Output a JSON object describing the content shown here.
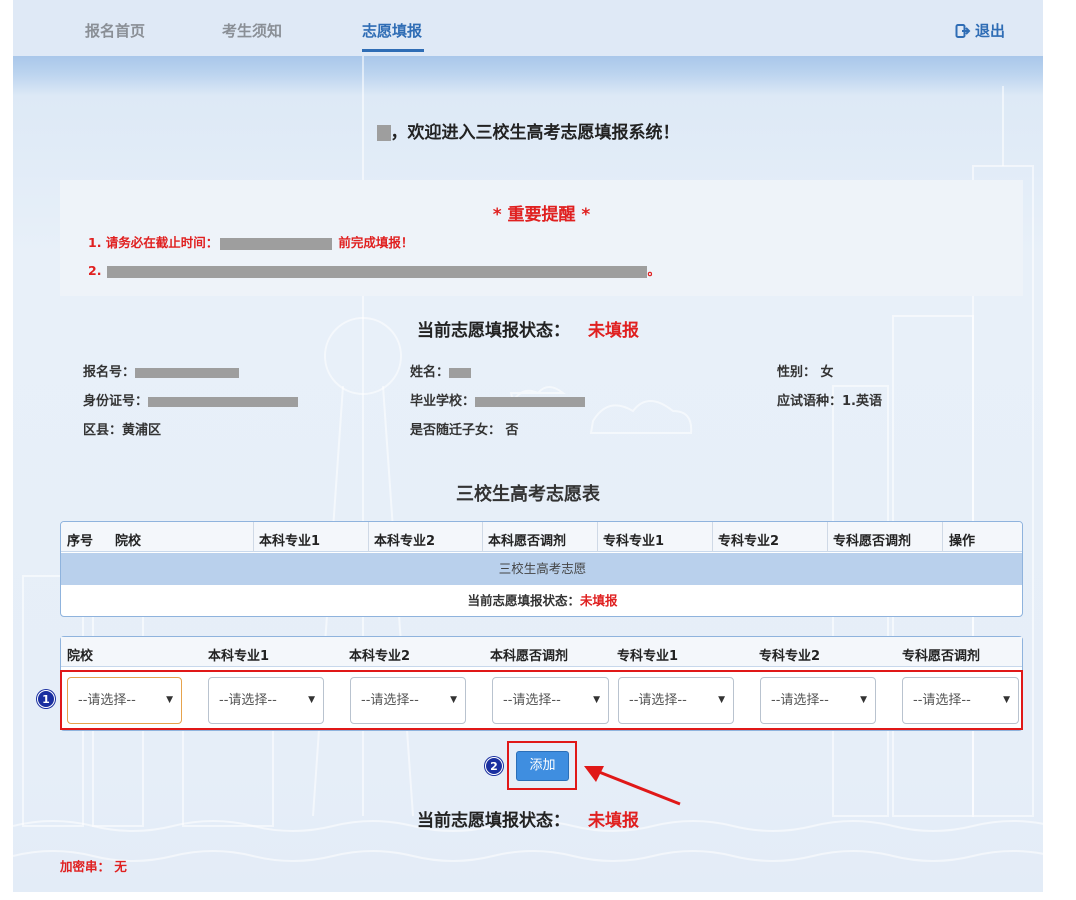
{
  "nav": {
    "tabs": [
      {
        "label": "报名首页",
        "active": false
      },
      {
        "label": "考生须知",
        "active": false
      },
      {
        "label": "志愿填报",
        "active": true
      }
    ],
    "logout_label": "退出"
  },
  "welcome": {
    "text": "，欢迎进入三校生高考志愿填报系统！"
  },
  "notice": {
    "title": "* 重要提醒 *",
    "line1_prefix": "1. 请务必在截止时间：",
    "line1_suffix": "前完成填报！",
    "line2_prefix": "2.",
    "line2_suffix": "。"
  },
  "status": {
    "label": "当前志愿填报状态：",
    "value": "未填报"
  },
  "student": {
    "reg_no_label": "报名号：",
    "name_label": "姓名：",
    "gender_label": "性别：",
    "gender_value": "女",
    "id_label": "身份证号：",
    "school_label": "毕业学校：",
    "language_label": "应试语种：",
    "language_value": "1.英语",
    "district_label": "区县：",
    "district_value": "黄浦区",
    "migrant_label": "是否随迁子女：",
    "migrant_value": "否"
  },
  "table_title": "三校生高考志愿表",
  "summary_table": {
    "headers": [
      "序号",
      "院校",
      "本科专业1",
      "本科专业2",
      "本科愿否调剂",
      "专科专业1",
      "专科专业2",
      "专科愿否调剂",
      "操作"
    ],
    "group_label": "三校生高考志愿",
    "status_label": "当前志愿填报状态：",
    "status_value": "未填报"
  },
  "form_table": {
    "headers": [
      "院校",
      "本科专业1",
      "本科专业2",
      "本科愿否调剂",
      "专科专业1",
      "专科专业2",
      "专科愿否调剂"
    ],
    "select_placeholder": "--请选择--"
  },
  "annotations": {
    "badge1": "1",
    "badge2": "2"
  },
  "add_button": "添加",
  "footer_status": {
    "label": "当前志愿填报状态：",
    "value": "未填报"
  },
  "cipher": {
    "label": "加密串：",
    "value": "无"
  },
  "colors": {
    "accent": "#2f6db5",
    "alert": "#e02020",
    "annotation": "#e01818",
    "button": "#3f8ee0"
  }
}
